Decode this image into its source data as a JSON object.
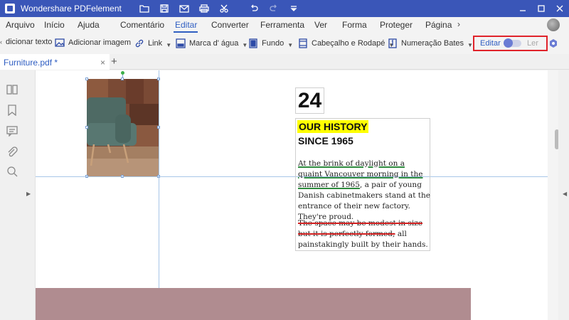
{
  "window": {
    "app_title": "Wondershare PDFelement",
    "icons": [
      "open-folder-icon",
      "save-icon",
      "mail-icon",
      "print-icon",
      "scissors-icon",
      "undo-icon",
      "redo-icon",
      "dropdown-arrow-icon"
    ]
  },
  "menu": {
    "items": [
      "Arquivo",
      "Início",
      "Ajuda",
      "Comentário",
      "Editar",
      "Converter",
      "Ferramenta",
      "Ver",
      "Forma",
      "Proteger",
      "Página"
    ],
    "active": "Editar",
    "more": "›"
  },
  "toolbar": {
    "add_text": "dicionar texto",
    "add_image": "Adicionar imagem",
    "link": "Link",
    "watermark": "Marca d' água",
    "background": "Fundo",
    "header_footer": "Cabeçalho e Rodapé",
    "bates": "Numeração Bates",
    "mode_edit": "Editar",
    "mode_read": "Ler",
    "accent": "#2f5ec2",
    "highlight_border": "#e0232a"
  },
  "tabs": {
    "file_tab": "Furniture.pdf *",
    "close": "×",
    "add": "+"
  },
  "document": {
    "page_number": "24",
    "history_title": "OUR HISTORY",
    "since": "SINCE 1965",
    "para1_underlined": "At the brink of daylight on a quaint Vancouver morning in the summer of 1965",
    "para1_rest": ", a pair of young Danish cabinetmakers stand at the entrance of their new factory. They're proud.",
    "para2_struck": "The space may be modest in size but it is perfectly formed;",
    "para2_rest": " all painstakingly built by their hands.",
    "colors": {
      "title_highlight": "#ffff00",
      "underline": "#2e8b3e",
      "strikethrough": "#d02020",
      "footer_band": "#b08c90"
    }
  }
}
